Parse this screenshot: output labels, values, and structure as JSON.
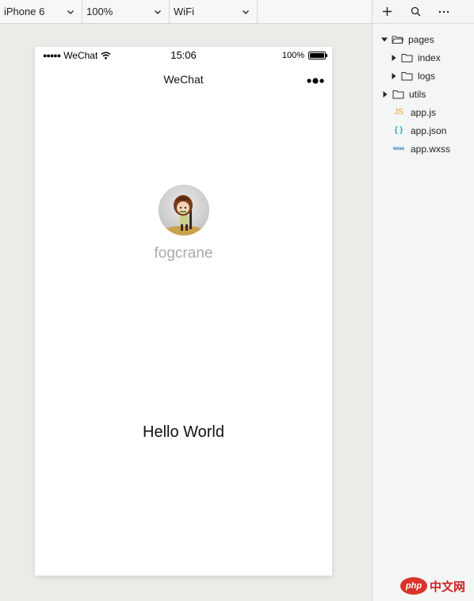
{
  "toolbar": {
    "device": "iPhone 6",
    "zoom": "100%",
    "network": "WiFi"
  },
  "phone": {
    "status": {
      "carrier": "WeChat",
      "time": "15:06",
      "battery": "100%",
      "battery_level": 1.0
    },
    "nav_title": "WeChat",
    "username": "fogcrane",
    "hello": "Hello World"
  },
  "panel": {
    "tools": [
      "plus-icon",
      "search-icon",
      "more-icon"
    ],
    "tree": [
      {
        "label": "pages",
        "type": "folder",
        "expanded": true,
        "depth": 0
      },
      {
        "label": "index",
        "type": "folder",
        "expanded": false,
        "depth": 1
      },
      {
        "label": "logs",
        "type": "folder",
        "expanded": false,
        "depth": 1
      },
      {
        "label": "utils",
        "type": "folder",
        "expanded": false,
        "depth": 0
      },
      {
        "label": "app.js",
        "type": "js",
        "icon_text": "JS",
        "depth": 0
      },
      {
        "label": "app.json",
        "type": "json",
        "icon_text": "{ }",
        "depth": 0
      },
      {
        "label": "app.wxss",
        "type": "wxss",
        "icon_text": "wxss",
        "depth": 0
      }
    ]
  },
  "watermark": {
    "logo_text": "php",
    "site_text": "中文网"
  },
  "colors": {
    "js": "#e8a317",
    "json": "#2f9bd6",
    "wxss": "#1d74c6",
    "username": "#aaaaaa",
    "background": "#ecebe7"
  }
}
